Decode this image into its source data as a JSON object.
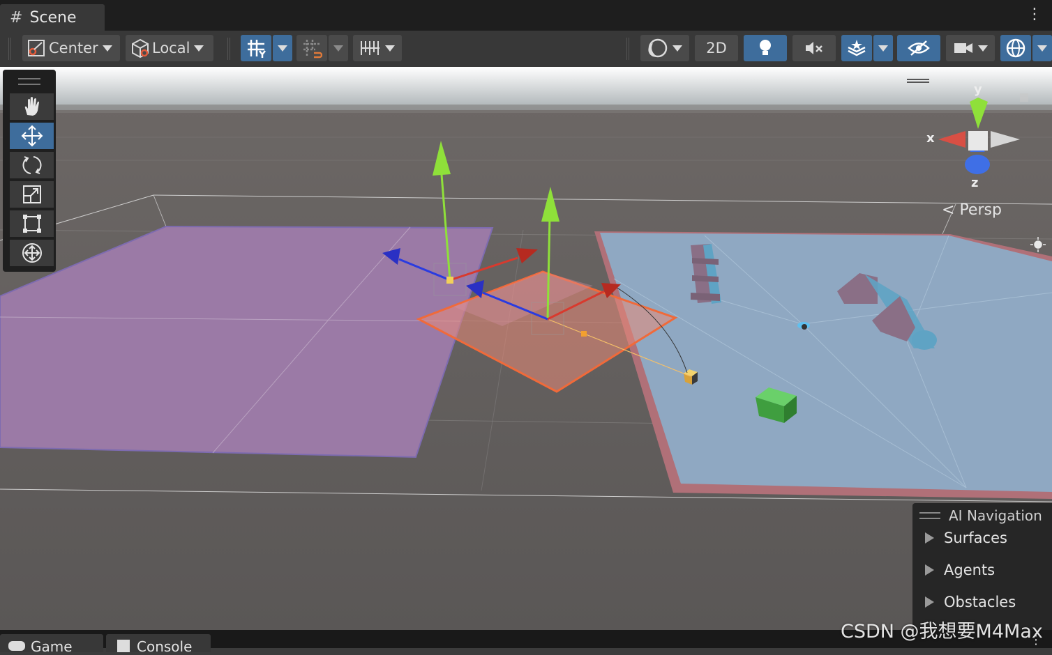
{
  "window": {
    "tab_title": "Scene",
    "tab_icon": "grid-icon"
  },
  "toolbar": {
    "pivot_label": "Center",
    "handle_label": "Local",
    "mode_2d_label": "2D"
  },
  "tools": [
    "hand",
    "move",
    "rotate",
    "scale",
    "rect",
    "transform"
  ],
  "active_tool": "move",
  "scene": {
    "view_label": "Persp",
    "gizmo_axes": {
      "x": "x",
      "y": "y",
      "z": "z"
    }
  },
  "ai_navigation": {
    "title": "AI Navigation",
    "items": [
      "Surfaces",
      "Agents",
      "Obstacles"
    ]
  },
  "bottom_tabs": {
    "game": "Game",
    "console": "Console"
  },
  "watermark": "CSDN @我想要M4Max",
  "colors": {
    "selection_blue": "#3e6d9c",
    "navmesh_magenta": "#9b7aa6",
    "navmesh_blue": "#8fa8c2",
    "gizmo_x": "#d83a2e",
    "gizmo_y": "#8fe03a",
    "gizmo_z": "#2a3be0"
  }
}
